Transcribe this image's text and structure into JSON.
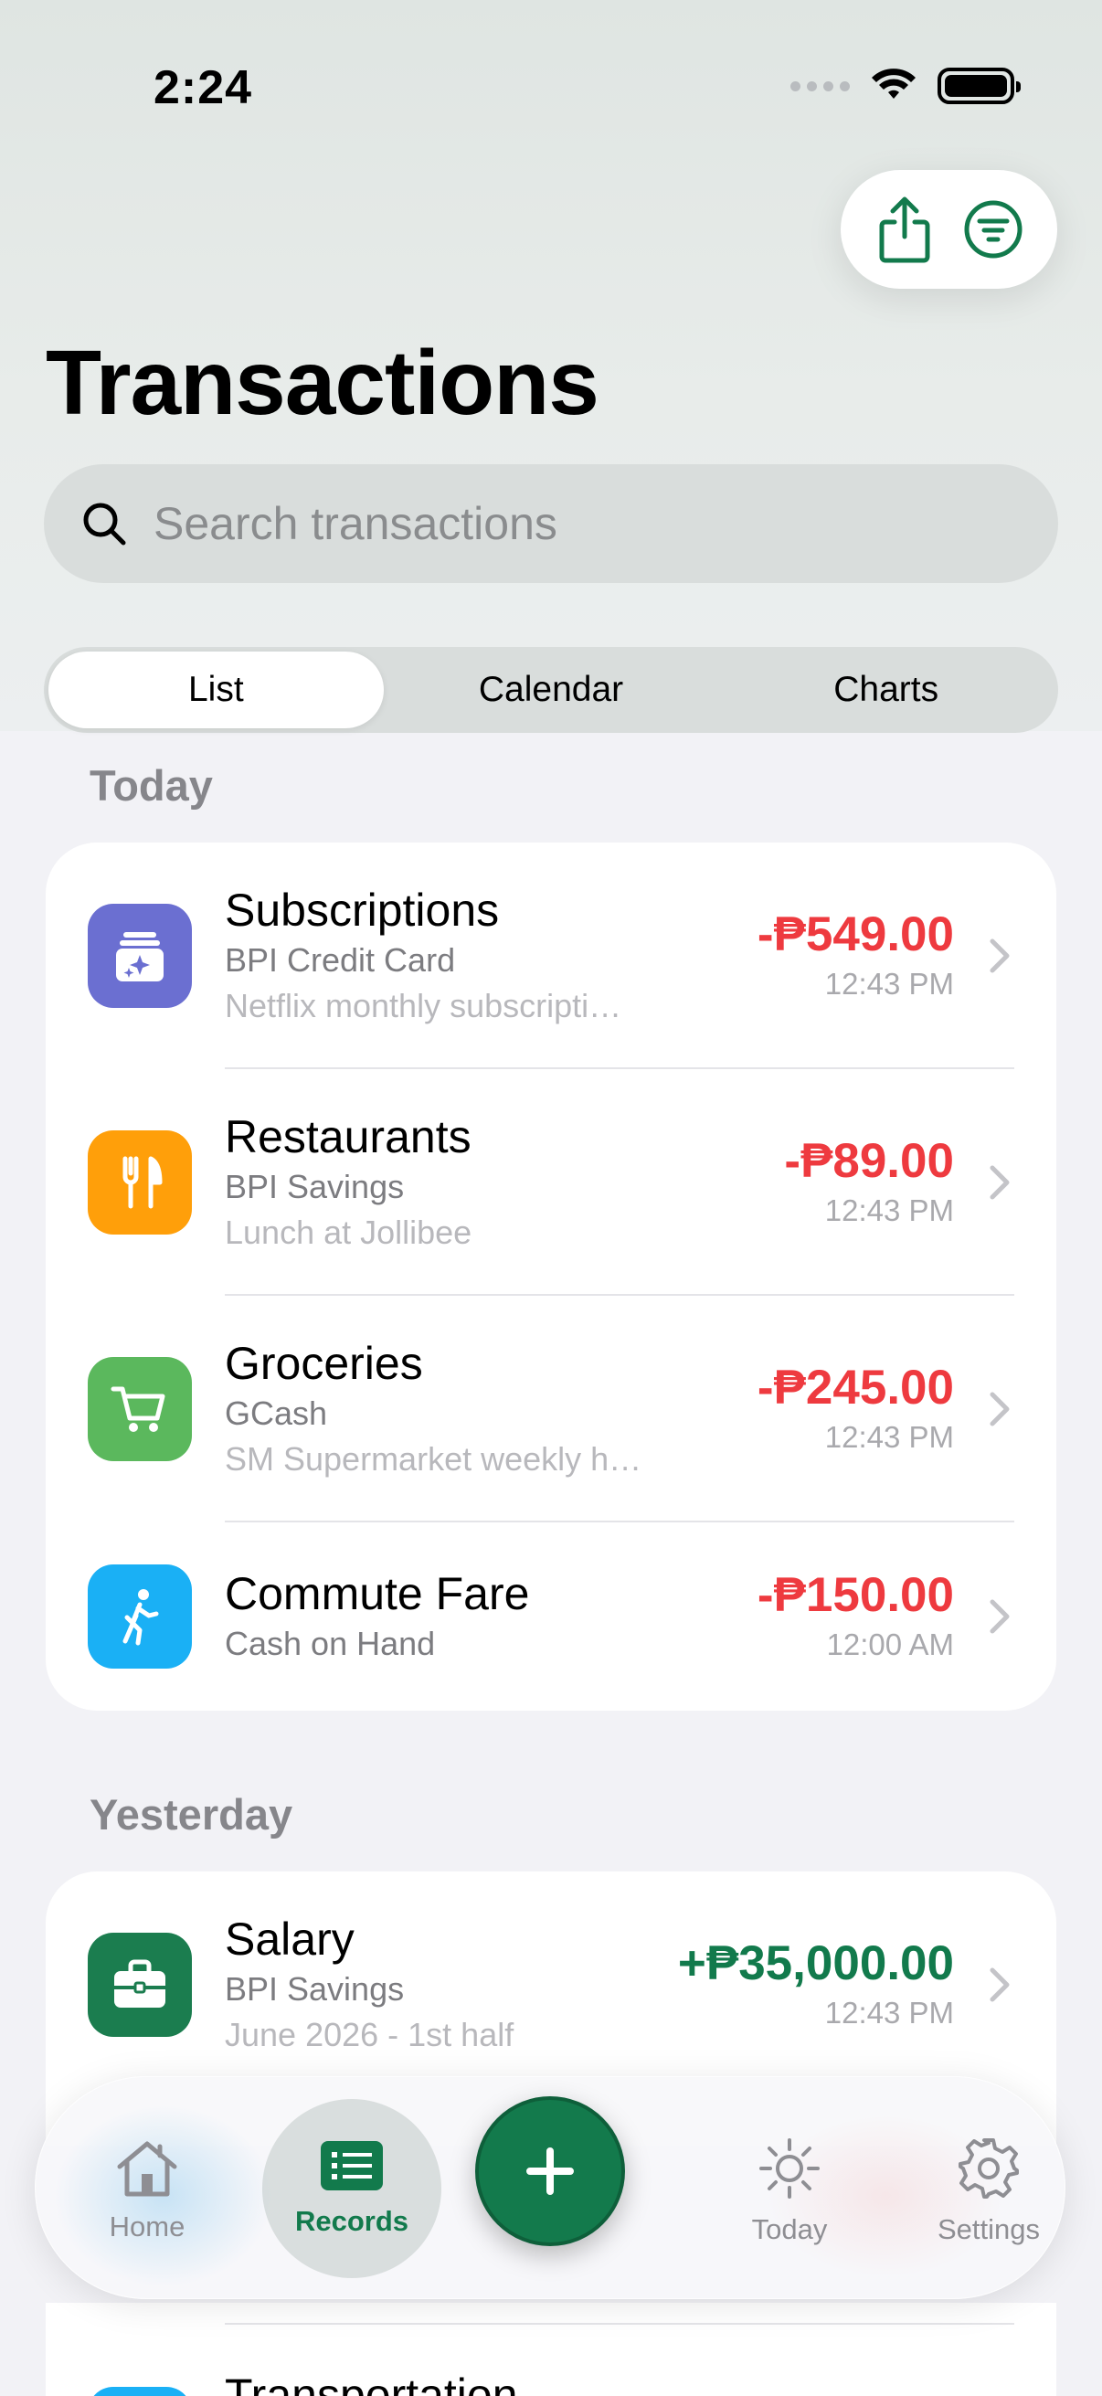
{
  "status": {
    "time": "2:24"
  },
  "header": {
    "title": "Transactions"
  },
  "search": {
    "placeholder": "Search transactions"
  },
  "segments": [
    "List",
    "Calendar",
    "Charts"
  ],
  "sections": [
    {
      "label": "Today",
      "rows": [
        {
          "name": "Subscriptions",
          "account": "BPI Credit Card",
          "note": "Netflix monthly subscripti…",
          "amount": "-₱549.00",
          "time": "12:43 PM",
          "icon": "subscriptions-icon",
          "color": "#6b6fd1"
        },
        {
          "name": "Restaurants",
          "account": "BPI Savings",
          "note": "Lunch at Jollibee",
          "amount": "-₱89.00",
          "time": "12:43 PM",
          "icon": "fork-knife-icon",
          "color": "#ff9f0a"
        },
        {
          "name": "Groceries",
          "account": "GCash",
          "note": "SM Supermarket weekly h…",
          "amount": "-₱245.00",
          "time": "12:43 PM",
          "icon": "cart-icon",
          "color": "#5bb85d"
        },
        {
          "name": "Commute Fare",
          "account": "Cash on Hand",
          "note": "",
          "amount": "-₱150.00",
          "time": "12:00 AM",
          "icon": "walking-icon",
          "color": "#1ab0f5"
        }
      ]
    },
    {
      "label": "Yesterday",
      "rows": [
        {
          "name": "Salary",
          "account": "BPI Savings",
          "note": "June 2026 - 1st half",
          "amount": "+₱35,000.00",
          "time": "12:43 PM",
          "icon": "briefcase-icon",
          "color": "#1b7d4f"
        },
        {
          "name": "Transportation",
          "account": "",
          "note": "",
          "amount": "",
          "time": "",
          "icon": "car-icon",
          "color": "#1ab0f5"
        }
      ]
    }
  ],
  "tabbar": {
    "home": "Home",
    "records": "Records",
    "today": "Today",
    "settings": "Settings"
  },
  "colors": {
    "accent": "#127a4c",
    "expense": "#ee3a3f",
    "income": "#127a4c"
  }
}
